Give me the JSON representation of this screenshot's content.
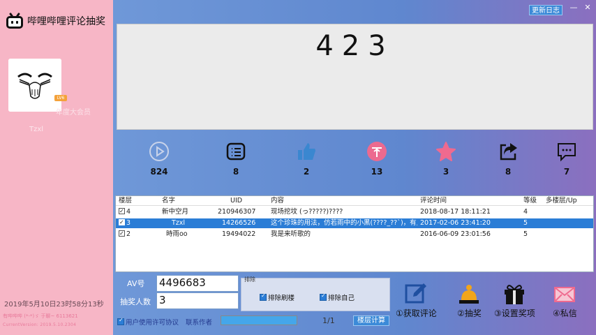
{
  "app": {
    "title": "哔哩哔哩评论抽奖"
  },
  "user": {
    "level_badge": "LV6",
    "vip_label": "年度大会员",
    "nickname": "Tzxl"
  },
  "footer_left": {
    "datetime": "2019年5月10日23时58分13秒",
    "copyright": "有哔哔哔 (*-*)ゞ 于聊~ 6113621",
    "version": "CurrentVersion: 2019.5.10.2304"
  },
  "window": {
    "minimize": "—",
    "close": "✕",
    "changelog_label": "更新日志"
  },
  "draw_display": {
    "number": "423"
  },
  "stats": [
    {
      "icon": "play-icon",
      "value": "824",
      "color": "#c8d3ea"
    },
    {
      "icon": "comment-list-icon",
      "value": "8",
      "color": "#111111"
    },
    {
      "icon": "thumbs-up-icon",
      "value": "2",
      "color": "#3a87d0"
    },
    {
      "icon": "coin-icon",
      "value": "13",
      "color": "#ec6a8f"
    },
    {
      "icon": "star-icon",
      "value": "3",
      "color": "#ef6a8f"
    },
    {
      "icon": "share-icon",
      "value": "8",
      "color": "#111111"
    },
    {
      "icon": "message-icon",
      "value": "7",
      "color": "#111111"
    }
  ],
  "table": {
    "headers": [
      "楼层",
      "名字",
      "UID",
      "内容",
      "评论时间",
      "等级",
      "多楼层/Up"
    ],
    "rows": [
      {
        "floor": "4",
        "name": "新中空月",
        "uid": "210946307",
        "content": "现场挖坟 (っ?????)????",
        "time": "2018-08-17 18:11:21",
        "level": "4",
        "multi": "",
        "checked": true,
        "selected": false
      },
      {
        "floor": "3",
        "name": "Tzxl",
        "uid": "14266526",
        "content": "这个珍珠的用法，仿若雨中的小黑(????_??`)，有点爽",
        "time": "2017-02-06 23:41:20",
        "level": "5",
        "multi": "",
        "checked": true,
        "selected": true
      },
      {
        "floor": "2",
        "name": "時雨oo",
        "uid": "19494022",
        "content": "我是来听歌的",
        "time": "2016-06-09 23:01:56",
        "level": "5",
        "multi": "",
        "checked": true,
        "selected": false
      }
    ]
  },
  "form": {
    "av_label": "AV号",
    "av_value": "4496683",
    "count_label": "抽奖人数",
    "count_value": "3",
    "exclude_group_title": "排除",
    "exclude_floor_label": "排除刷楼",
    "exclude_self_label": "排除自己",
    "agree_label": "用户使用许可协议",
    "contact_label": "联系作者",
    "progress": 1.0,
    "page_indicator": "1/1",
    "floor_calc_label": "楼层计算"
  },
  "actions": [
    {
      "icon": "edit-icon",
      "label": "①获取评论",
      "color": "#1f4fa0"
    },
    {
      "icon": "lottery-bell-icon",
      "label": "②抽奖",
      "color": "#f2a51a"
    },
    {
      "icon": "gift-icon",
      "label": "③设置奖项",
      "color": "#111111"
    },
    {
      "icon": "mail-icon",
      "label": "④私信",
      "color": "#ef6a8f"
    }
  ]
}
